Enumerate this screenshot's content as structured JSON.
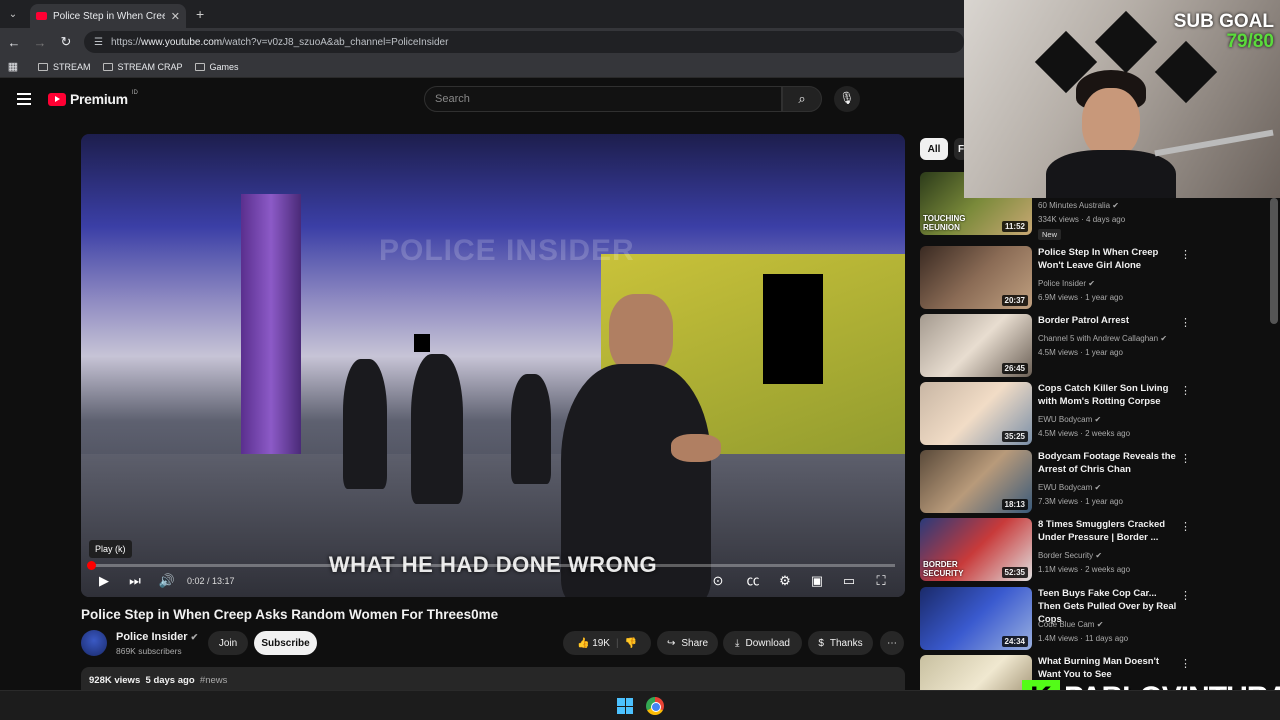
{
  "browser": {
    "tab_title": "Police Step in When Creep Asks",
    "url_prefix": "https://",
    "url_host": "www.youtube.com",
    "url_path": "/watch?v=v0zJ8_szuoA&ab_channel=PoliceInsider",
    "bookmarks": [
      "STREAM",
      "STREAM CRAP",
      "Games"
    ]
  },
  "header": {
    "logo_text": "Premium",
    "region": "ID",
    "search_placeholder": "Search"
  },
  "player": {
    "watermark": "POLICE INSIDER",
    "caption": "WHAT HE HAD DONE WRONG",
    "tooltip": "Play (k)",
    "time": "0:02 / 13:17",
    "progress_fraction": 0.003
  },
  "video": {
    "title": "Police Step in When Creep Asks Random Women For Threes0me",
    "channel": "Police Insider",
    "subscribers": "869K subscribers",
    "join_label": "Join",
    "subscribe_label": "Subscribe",
    "likes": "19K",
    "share_label": "Share",
    "download_label": "Download",
    "thanks_label": "Thanks",
    "views": "928K views",
    "age": "5 days ago",
    "hashtag": "#news"
  },
  "sidebar": {
    "chips": [
      "All",
      "F"
    ],
    "recommendations": [
      {
        "title": "",
        "channel": "60 Minutes Australia",
        "meta": "334K views · 4 days ago",
        "duration": "11:52",
        "badge": "New",
        "thumb_text": "TOUCHING REUNION"
      },
      {
        "title": "Police Step In When Creep Won't Leave Girl Alone",
        "channel": "Police Insider",
        "meta": "6.9M views · 1 year ago",
        "duration": "20:37"
      },
      {
        "title": "Border Patrol Arrest",
        "channel": "Channel 5 with Andrew Callaghan",
        "meta": "4.5M views · 1 year ago",
        "duration": "26:45"
      },
      {
        "title": "Cops Catch Killer Son Living with Mom's Rotting Corpse",
        "channel": "EWU Bodycam",
        "meta": "4.5M views · 2 weeks ago",
        "duration": "35:25"
      },
      {
        "title": "Bodycam Footage Reveals the Arrest of Chris Chan",
        "channel": "EWU Bodycam",
        "meta": "7.3M views · 1 year ago",
        "duration": "18:13"
      },
      {
        "title": "8 Times Smugglers Cracked Under Pressure | Border ...",
        "channel": "Border Security",
        "meta": "1.1M views · 2 weeks ago",
        "duration": "52:35",
        "thumb_text": "BORDER SECURITY"
      },
      {
        "title": "Teen Buys Fake Cop Car... Then Gets Pulled Over by Real Cops",
        "channel": "Code Blue Cam",
        "meta": "1.4M views · 11 days ago",
        "duration": "24:34"
      },
      {
        "title": "What Burning Man Doesn't Want You to See",
        "channel": "",
        "meta": "",
        "duration": ""
      }
    ]
  },
  "overlay": {
    "sub_goal_label": "SUB GOAL",
    "sub_goal_value": "79/80",
    "streamer_badge": "K",
    "streamer_name": "PABLOVINTURA"
  },
  "colors": {
    "accent": "#ff0033",
    "kick_green": "#53fc18",
    "background": "#0f0f0f"
  }
}
